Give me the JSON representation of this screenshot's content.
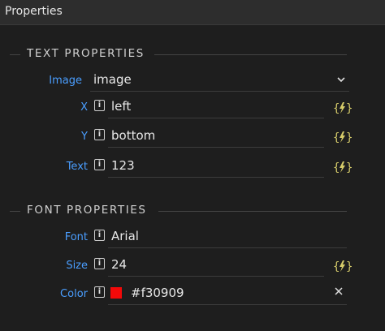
{
  "window": {
    "title": "Properties"
  },
  "sections": {
    "text": {
      "title": "TEXT PROPERTIES",
      "image_label": "Image",
      "image_value": "image",
      "x_label": "X",
      "x_value": "left",
      "y_label": "Y",
      "y_value": "bottom",
      "text_label": "Text",
      "text_value": "123"
    },
    "font": {
      "title": "FONT PROPERTIES",
      "font_label": "Font",
      "font_value": "Arial",
      "size_label": "Size",
      "size_value": "24",
      "color_label": "Color",
      "color_value": "#f30909"
    }
  },
  "icons": {
    "info": "info-icon",
    "binding": "lightning-bolt-braces-icon",
    "dropdown": "chevron-down-icon",
    "clear": "close-icon"
  },
  "colors": {
    "label": "#4a9eff",
    "swatch": "#f30909",
    "bolt": "#d6cc6a",
    "background": "#1e1e1e"
  }
}
